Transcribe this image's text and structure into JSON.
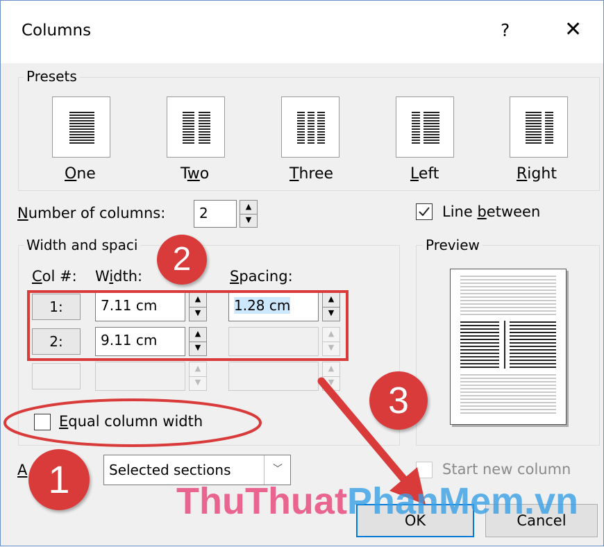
{
  "dialog": {
    "title": "Columns",
    "help_label": "?",
    "close_label": "✕"
  },
  "presets": {
    "legend": "Presets",
    "items": [
      {
        "mnemonic": "O",
        "rest": "ne"
      },
      {
        "prefix": "T",
        "mnemonic": "w",
        "rest": "o"
      },
      {
        "mnemonic": "T",
        "rest": "hree"
      },
      {
        "mnemonic": "L",
        "rest": "eft"
      },
      {
        "mnemonic": "R",
        "rest": "ight"
      }
    ]
  },
  "number_of_columns": {
    "mnemonic": "N",
    "rest": "umber of columns:",
    "value": "2"
  },
  "line_between": {
    "prefix": "Line ",
    "mnemonic": "b",
    "rest": "etween",
    "checked": true
  },
  "width_spacing": {
    "legend": "Width and spaci",
    "col_header": {
      "mnemonic": "C",
      "rest": "ol #:"
    },
    "width_header": {
      "prefix": "W",
      "mnemonic": "i",
      "rest": "dth:"
    },
    "spacing_header": {
      "mnemonic": "S",
      "rest": "pacing:"
    },
    "rows": [
      {
        "col": "1:",
        "width": "7.11 cm",
        "spacing": "1.28 cm"
      },
      {
        "col": "2:",
        "width": "9.11 cm",
        "spacing": ""
      },
      {
        "col": "",
        "width": "",
        "spacing": ""
      }
    ]
  },
  "equal_column_width": {
    "mnemonic": "E",
    "rest": "qual column width",
    "checked": false
  },
  "preview": {
    "legend": "Preview"
  },
  "apply_to": {
    "label": "A",
    "value": "Selected sections"
  },
  "start_new_column": {
    "label": "Start new column",
    "checked": false
  },
  "buttons": {
    "ok": "OK",
    "cancel": "Cancel"
  },
  "annotations": {
    "step1": "1",
    "step2": "2",
    "step3": "3"
  },
  "watermark": {
    "part1": "ThuThuat",
    "part2": "PhanMem.vn"
  },
  "colors": {
    "annotation_red": "#d93a3a",
    "selection_blue": "#cce8ff",
    "default_button_border": "#0078d7"
  }
}
